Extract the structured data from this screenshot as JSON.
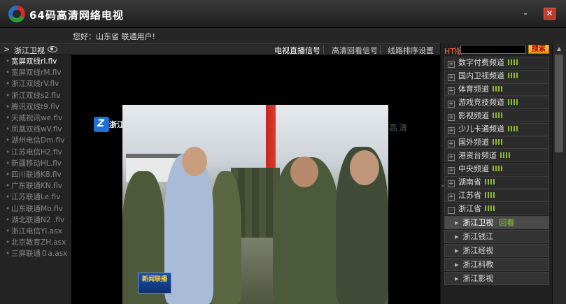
{
  "app": {
    "title": "64码高清网络电视",
    "minimize": "-",
    "close": "✕"
  },
  "greeting": "您好：山东省 联通用户!",
  "sidebar": {
    "arrow": ">",
    "title": "浙江卫视"
  },
  "tabs": [
    {
      "label": "电视直播信号",
      "active": true
    },
    {
      "label": "高清回看信号",
      "active": false
    },
    {
      "label": "线路排序设置",
      "active": false
    }
  ],
  "files": [
    "宽屏双线rl.flv",
    "宽屏双线rM.flv",
    "浙江双线rV.flv",
    "浙江双线s2.flv",
    "腾讯双线t9.flv",
    "天威视讯we.flv",
    "凤凰双线wV.flv",
    "湖州电信Dm.flv",
    "江苏电信H2.flv",
    "新疆移动HL.flv",
    "四川联通K8.flv",
    "广东联通KN.flv",
    "江苏联通Le.flv",
    "山东联通Mb.flv",
    "湖北联通N2 .flv",
    "浙江电信Yl.asx",
    "北京教育ZH.asx",
    "三屏联通０a.asx"
  ],
  "video": {
    "channel_logo": "浙江卫视",
    "hd_mark": "高清",
    "news_logo": "新闻联播"
  },
  "right": {
    "ht_label": "HT版",
    "search_value": "",
    "search_button": "搜索",
    "categories": [
      "数字付费频道",
      "国内卫视频道",
      "体育频道",
      "游戏竞技频道",
      "影视频道",
      "少儿卡通频道",
      "国外频道",
      "港资台频道",
      "中央频道",
      "湖南省",
      "江苏省",
      "浙江省"
    ],
    "expanded_sign": "-",
    "subitems": [
      {
        "label": "浙江卫视",
        "replay": "回看",
        "active": true
      },
      {
        "label": "浙江钱江",
        "replay": "",
        "active": false
      },
      {
        "label": "浙江经视",
        "replay": "",
        "active": false
      },
      {
        "label": "浙江科教",
        "replay": "",
        "active": false
      },
      {
        "label": "浙江影视",
        "replay": "",
        "active": false
      }
    ]
  },
  "colors": {
    "accent": "#8fbf2a",
    "close": "#c0392b",
    "search": "#e59a14"
  }
}
